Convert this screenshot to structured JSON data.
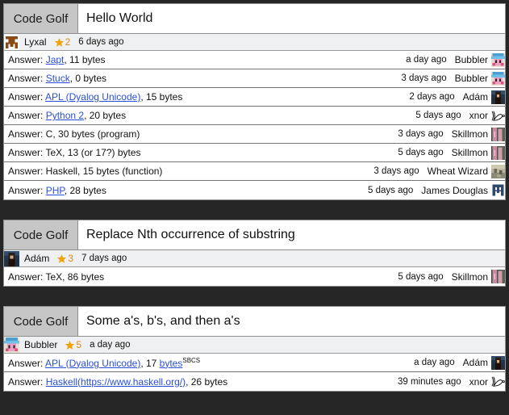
{
  "theme": {
    "page_background": "#262626",
    "card_background": "#ffffff",
    "tag_background": "#c6c6c6",
    "author_bar_background": "#eff0f1",
    "link_color": "#2b4fd4",
    "star_color": "#f0a30a",
    "score_color": "#e08a17",
    "border_color": "#8f8f8f"
  },
  "questions": [
    {
      "tag": "Code Golf",
      "title": "Hello World",
      "author": "Lyxal",
      "score": "2",
      "age": "6 days ago",
      "avatar": "lyxal-avatar",
      "answers": [
        {
          "prefix": "Answer: ",
          "link": "Japt",
          "link_url": "",
          "suffix": ", 11 bytes",
          "sup": "",
          "age": "a day ago",
          "author": "Bubbler",
          "avatar": "bubbler-avatar"
        },
        {
          "prefix": "Answer: ",
          "link": "Stuck",
          "link_url": "",
          "suffix": ", 0 bytes",
          "sup": "",
          "age": "3 days ago",
          "author": "Bubbler",
          "avatar": "bubbler-avatar"
        },
        {
          "prefix": "Answer: ",
          "link": "APL (Dyalog Unicode)",
          "link_url": "",
          "suffix": ", 15 bytes",
          "sup": "",
          "age": "2 days ago",
          "author": "Adám",
          "avatar": "adam-avatar"
        },
        {
          "prefix": "Answer: ",
          "link": "Python 2",
          "link_url": "",
          "suffix": ", 20 bytes",
          "sup": "",
          "age": "5 days ago",
          "author": "xnor",
          "avatar": "xnor-avatar"
        },
        {
          "prefix": "Answer: C, 30 bytes (program)",
          "link": "",
          "link_url": "",
          "suffix": "",
          "sup": "",
          "age": "3 days ago",
          "author": "Skillmon",
          "avatar": "skillmon-avatar"
        },
        {
          "prefix": "Answer: TeX, 13 (or 17?) bytes",
          "link": "",
          "link_url": "",
          "suffix": "",
          "sup": "",
          "age": "5 days ago",
          "author": "Skillmon",
          "avatar": "skillmon-avatar"
        },
        {
          "prefix": "Answer: Haskell, 15 bytes (function)",
          "link": "",
          "link_url": "",
          "suffix": "",
          "sup": "",
          "age": "3 days ago",
          "author": "Wheat Wizard",
          "avatar": "wheatwizard-avatar"
        },
        {
          "prefix": "Answer: ",
          "link": "PHP",
          "link_url": "",
          "suffix": ", 28 bytes",
          "sup": "",
          "age": "5 days ago",
          "author": "James Douglas",
          "avatar": "jamesdouglas-avatar"
        }
      ]
    },
    {
      "tag": "Code Golf",
      "title": "Replace Nth occurrence of substring",
      "author": "Adám",
      "score": "3",
      "age": "7 days ago",
      "avatar": "adam-avatar",
      "answers": [
        {
          "prefix": "Answer: TeX, 86 bytes",
          "link": "",
          "link_url": "",
          "suffix": "",
          "sup": "",
          "age": "5 days ago",
          "author": "Skillmon",
          "avatar": "skillmon-avatar"
        }
      ]
    },
    {
      "tag": "Code Golf",
      "title": "Some a's, b's, and then a's",
      "author": "Bubbler",
      "score": "5",
      "age": "a day ago",
      "avatar": "bubbler-avatar",
      "answers": [
        {
          "prefix": "Answer: ",
          "link": "APL (Dyalog Unicode)",
          "link_url": "",
          "suffix": ", 17 ",
          "link2": "bytes",
          "sup": "SBCS",
          "age": "a day ago",
          "author": "Adám",
          "avatar": "adam-avatar"
        },
        {
          "prefix": "Answer: ",
          "link": "Haskell",
          "link_url": "",
          "suffix_link": "(https://www.haskell.org/)",
          "suffix": ", 26 bytes",
          "sup": "",
          "age": "39 minutes ago",
          "author": "xnor",
          "avatar": "xnor-avatar"
        }
      ]
    }
  ]
}
